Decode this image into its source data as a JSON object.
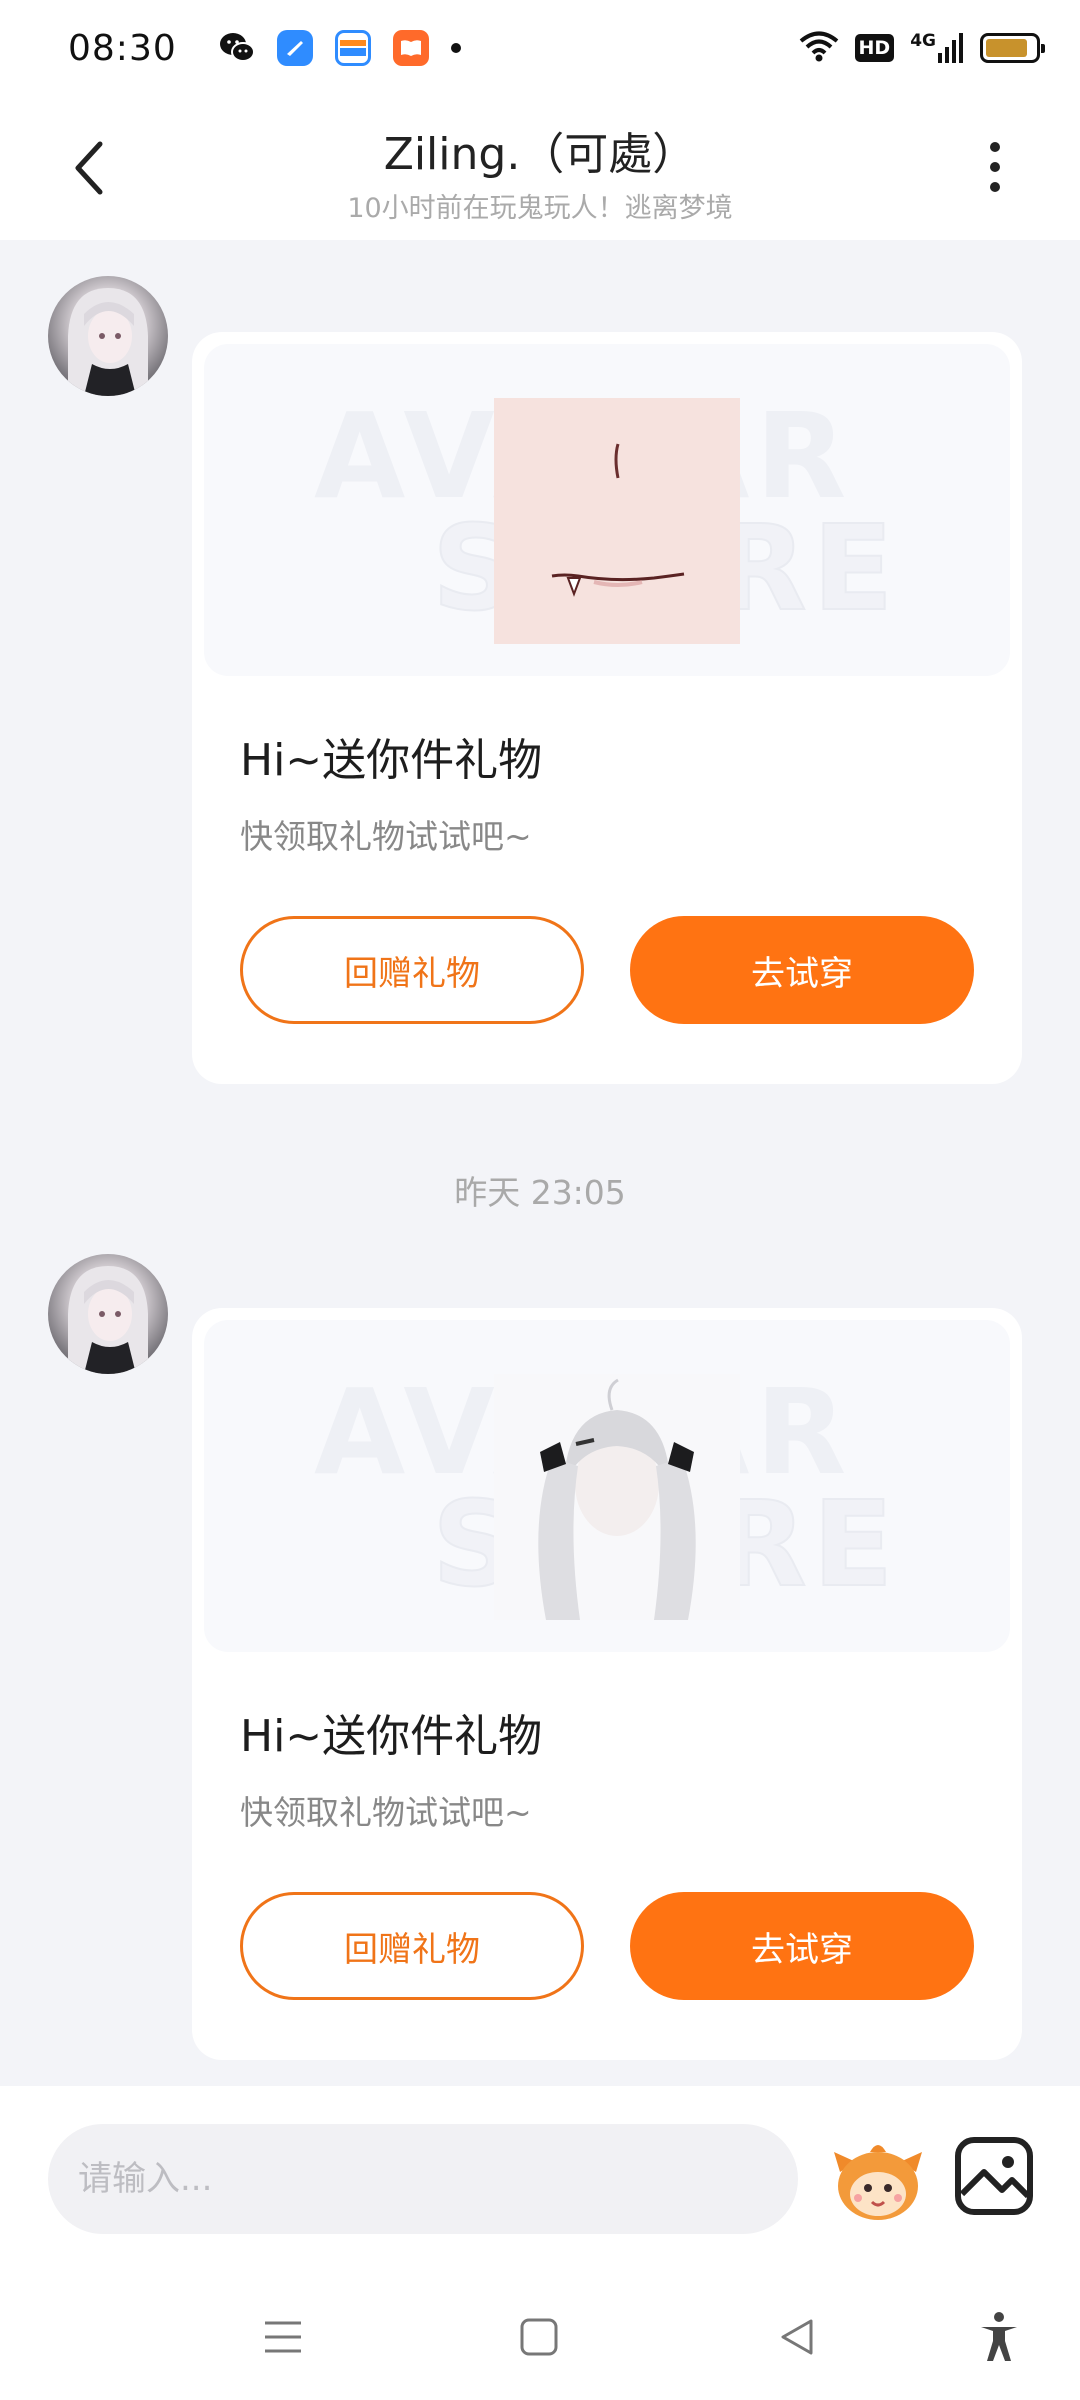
{
  "status_bar": {
    "time": "08:30",
    "app_icons": [
      "wechat-icon",
      "browser-icon",
      "wallet-icon",
      "reader-icon"
    ],
    "hd_label": "HD",
    "network_label": "4G",
    "battery_level": 0.85,
    "battery_color": "#c8922c"
  },
  "header": {
    "title": "Ziling.（可處）",
    "subtitle": "10小时前在玩鬼玩人！逃离梦境"
  },
  "messages": [
    {
      "type": "gift",
      "item_icon": "face-makeup-icon",
      "watermark_line1": "AVATAR",
      "watermark_line2": "STORE",
      "title": "Hi~送你件礼物",
      "description": "快领取礼物试试吧~",
      "return_button": "回赠礼物",
      "try_button": "去试穿"
    },
    {
      "type": "gift",
      "item_icon": "twin-tail-hair-icon",
      "watermark_line1": "AVATAR",
      "watermark_line2": "STORE",
      "title": "Hi~送你件礼物",
      "description": "快领取礼物试试吧~",
      "return_button": "回赠礼物",
      "try_button": "去试穿"
    }
  ],
  "timestamp": "昨天 23:05",
  "input": {
    "placeholder": "请输入..."
  },
  "colors": {
    "accent": "#ff7312",
    "accent_border": "#f07418",
    "background": "#f3f4f8"
  }
}
